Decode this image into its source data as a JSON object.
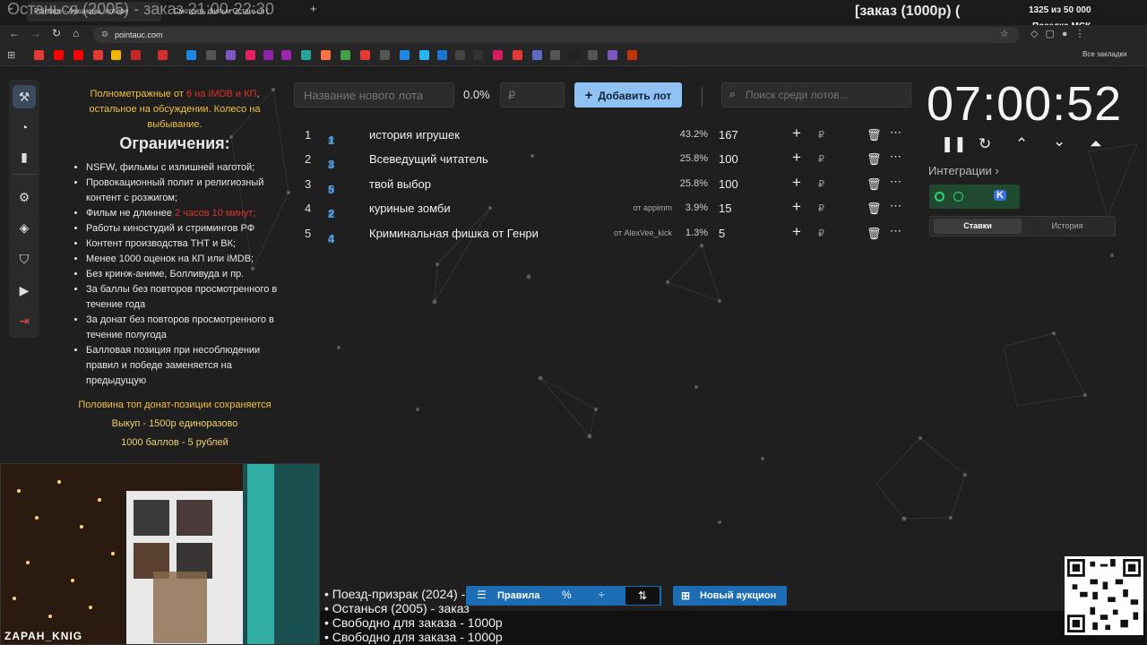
{
  "browser": {
    "tabs": [
      {
        "label": "Pointauc - Аукционы, лотере"
      },
      {
        "label": "Смотреть фильм Останься ("
      }
    ],
    "url": "pointauc.com",
    "bookmarks_all_label": "Все закладки"
  },
  "stream_overlay": {
    "title_text": "Останься (2005) - заказ 21:00-22:30",
    "order_label": "[заказ (1000р) (",
    "donation_count": "1325  из 50 000",
    "donation_goal": "Поездка МСК",
    "streamer_name": "ZAPAH_KNIG",
    "orders": [
      "• Поезд-призрак (2024) - а",
      "• Останься (2005) - заказ",
      "• Свободно для заказа - 1000р",
      "• Свободно для заказа - 1000р"
    ]
  },
  "rules": {
    "intro_part1": "Полнометражные от ",
    "intro_red": "6 на IMDB и КП",
    "intro_part2": ", остальное на обсуждении. Колесо на выбывание.",
    "heading": "Ограничения:",
    "items": [
      "NSFW, фильмы с излишней наготой;",
      "Провокационный полит и религиозный контент с розжигом;",
      "Фильм не длиннее ",
      "Работы киностудий и стримингов РФ",
      "Контент производства ТНТ и ВК;",
      "Менее 1000 оценок на КП или iMDB;",
      "Без кринж-аниме, Болливуда и пр.",
      "За баллы без повторов просмотренного в течение года",
      "За донат без повторов просмотренного в течение полугода",
      "Балловая позиция при несоблюдении правил и победе заменяется на предыдущую"
    ],
    "length_red": "2 часов 10 минут;",
    "footer": [
      "Половина топ донат-позиции сохраняется",
      "Выкуп - 1500р единоразово",
      "1000 баллов - 5 рублей"
    ]
  },
  "controls": {
    "lot_name_placeholder": "Название нового лота",
    "percent": "0.0%",
    "amount_placeholder": "₽",
    "add_lot_label": "Добавить лот",
    "search_placeholder": "Поиск среди лотов..."
  },
  "lots": [
    {
      "num": "1",
      "id": "1",
      "name": "история игрушек",
      "author": "",
      "percent": "43.2%",
      "amount": "167"
    },
    {
      "num": "2",
      "id": "3",
      "name": "Всеведущий читатель",
      "author": "",
      "percent": "25.8%",
      "amount": "100"
    },
    {
      "num": "3",
      "id": "5",
      "name": "твой выбор",
      "author": "",
      "percent": "25.8%",
      "amount": "100"
    },
    {
      "num": "4",
      "id": "2",
      "name": "куриные зомби",
      "author": "от appimm",
      "percent": "3.9%",
      "amount": "15"
    },
    {
      "num": "5",
      "id": "4",
      "name": "Криминальная фишка от Генри",
      "author": "от AlexVee_kick",
      "percent": "1.3%",
      "amount": "5"
    }
  ],
  "timer": {
    "value": "07:00:52",
    "integrations_label": "Интеграции",
    "tabs": {
      "bets": "Ставки",
      "history": "История"
    }
  },
  "toolbar": {
    "rules_label": "Правила",
    "new_auction_label": "Новый аукцион"
  },
  "colors": {
    "accent": "#8fc1f2",
    "toolbar_blue": "#1d6db5",
    "lot_id": "#5aa3e6",
    "warning_red": "#e0302a",
    "highlight_yellow": "#f0c040",
    "integration_green": "#1f4a30"
  }
}
